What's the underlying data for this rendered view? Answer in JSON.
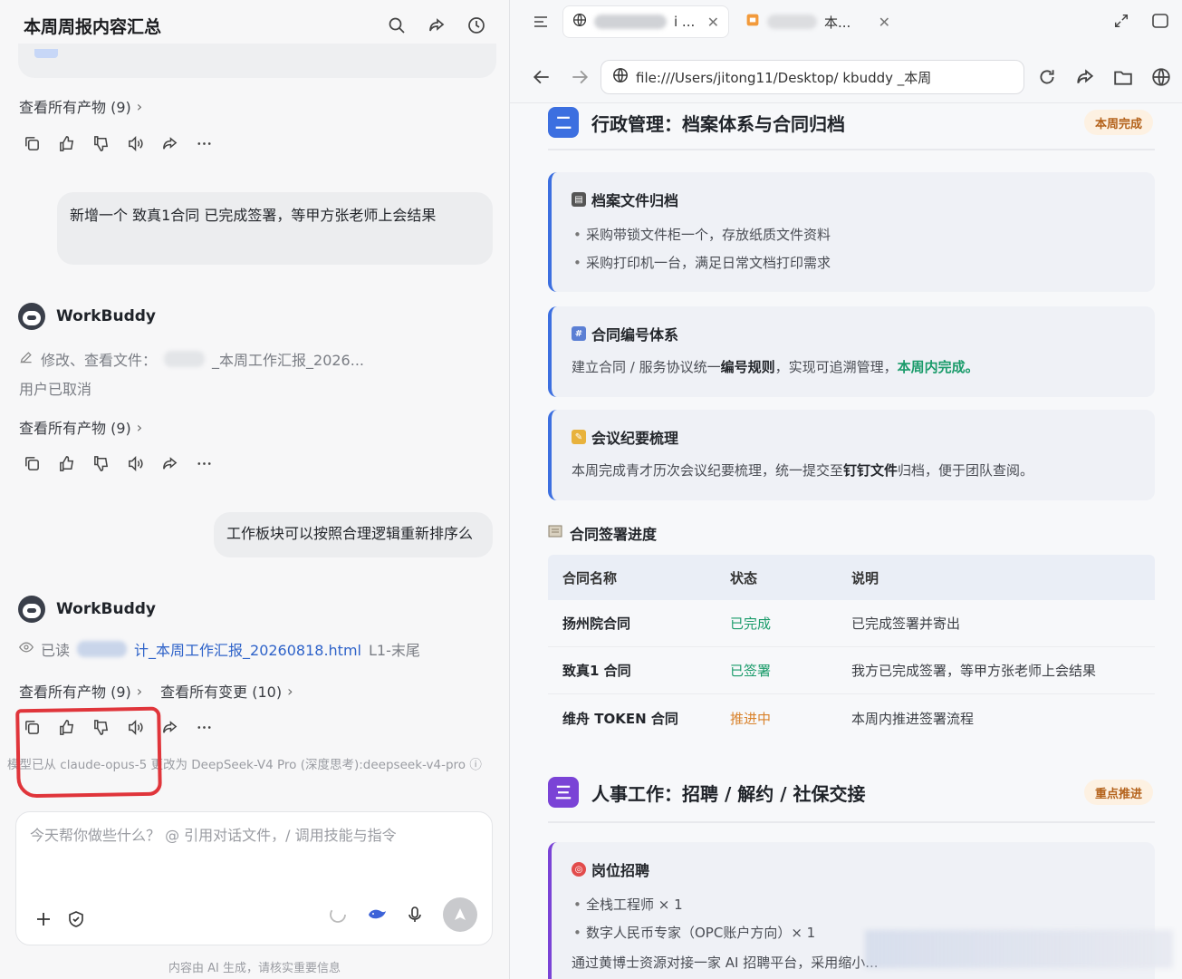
{
  "left": {
    "title": "本周周报内容汇总",
    "view_artifacts": "查看所有产物 (9)",
    "view_changes": "查看所有变更 (10)",
    "user_msg_1": "新增一个 致真​​1合同 已完成签署，等甲方张老师上会结果",
    "user_msg_2": "工作板块可以按照合理逻辑重新排序么",
    "bot_name": "WorkBuddy",
    "edit_line": "修改、查看文件：",
    "edit_file": "_本周工作汇报_2026...",
    "cancelled": "用户已取消",
    "read_label": "已读",
    "read_file": "计_本周工作汇报_20260818.html",
    "read_range": "L1-末尾",
    "model_line": "模型已从 claude-opus-5 更改为 DeepSeek-V4 Pro (深度思考):deepseek-v4-pro ⓘ",
    "input_placeholder": "今天帮你做些什么？ @ 引用对话文件，/ 调用技能与指令",
    "disclaimer": "内容由 AI 生成，请核实重要信息"
  },
  "browser": {
    "tab1_label": "i ...",
    "tab2_label": "本...",
    "url": "file:///Users/jitong11/Desktop/ kbuddy  _本周"
  },
  "page": {
    "section2": {
      "num": "二",
      "title": "行政管理：档案体系与合同归档",
      "badge": "本周完成",
      "badge_color": "#b4621b"
    },
    "card1": {
      "title": "档案文件归档",
      "items": [
        "采购带锁文件柜一个，存放纸质文件资料",
        "采购打印机一台，满足日常文档打印需求"
      ]
    },
    "card2": {
      "title": "合同编号体系",
      "text_a": "建立合同 / 服务协议统一",
      "text_b": "编号规则",
      "text_c": "，实现可追溯管理，",
      "text_d": "本周内完成。"
    },
    "card3": {
      "title": "会议纪要梳理",
      "text_a": "本周完成青才历次会议纪要梳理，统一提交至",
      "text_b": "钉钉文件",
      "text_c": "归档，便于团队查阅。"
    },
    "table_title": "合同签署进度",
    "table_headers": [
      "合同名称",
      "状态",
      "说明"
    ],
    "table_rows": [
      {
        "name": "扬州院合同",
        "status": "已完成",
        "status_color": "#1a9b6a",
        "note": "已完成签署并寄出"
      },
      {
        "name": "致真​​1 合同",
        "status": "已签署",
        "status_color": "#1a9b6a",
        "note": "我方已完成签署，等甲方张老师上会结果"
      },
      {
        "name": "维舟 TOKEN 合同",
        "status": "推进中",
        "status_color": "#d9822b",
        "note": "本周内推进签署流程"
      }
    ],
    "section3": {
      "num": "三",
      "title": "人事工作：招聘 / 解约 / 社保交接",
      "badge": "重点推进"
    },
    "card4": {
      "title": "岗位招聘",
      "items": [
        "全栈工程师 × 1",
        "数字人民币专家（OPC账户方向）× 1"
      ],
      "text": "通过黄博士资源对接一家 AI 招聘平台，采用缩小..."
    }
  }
}
